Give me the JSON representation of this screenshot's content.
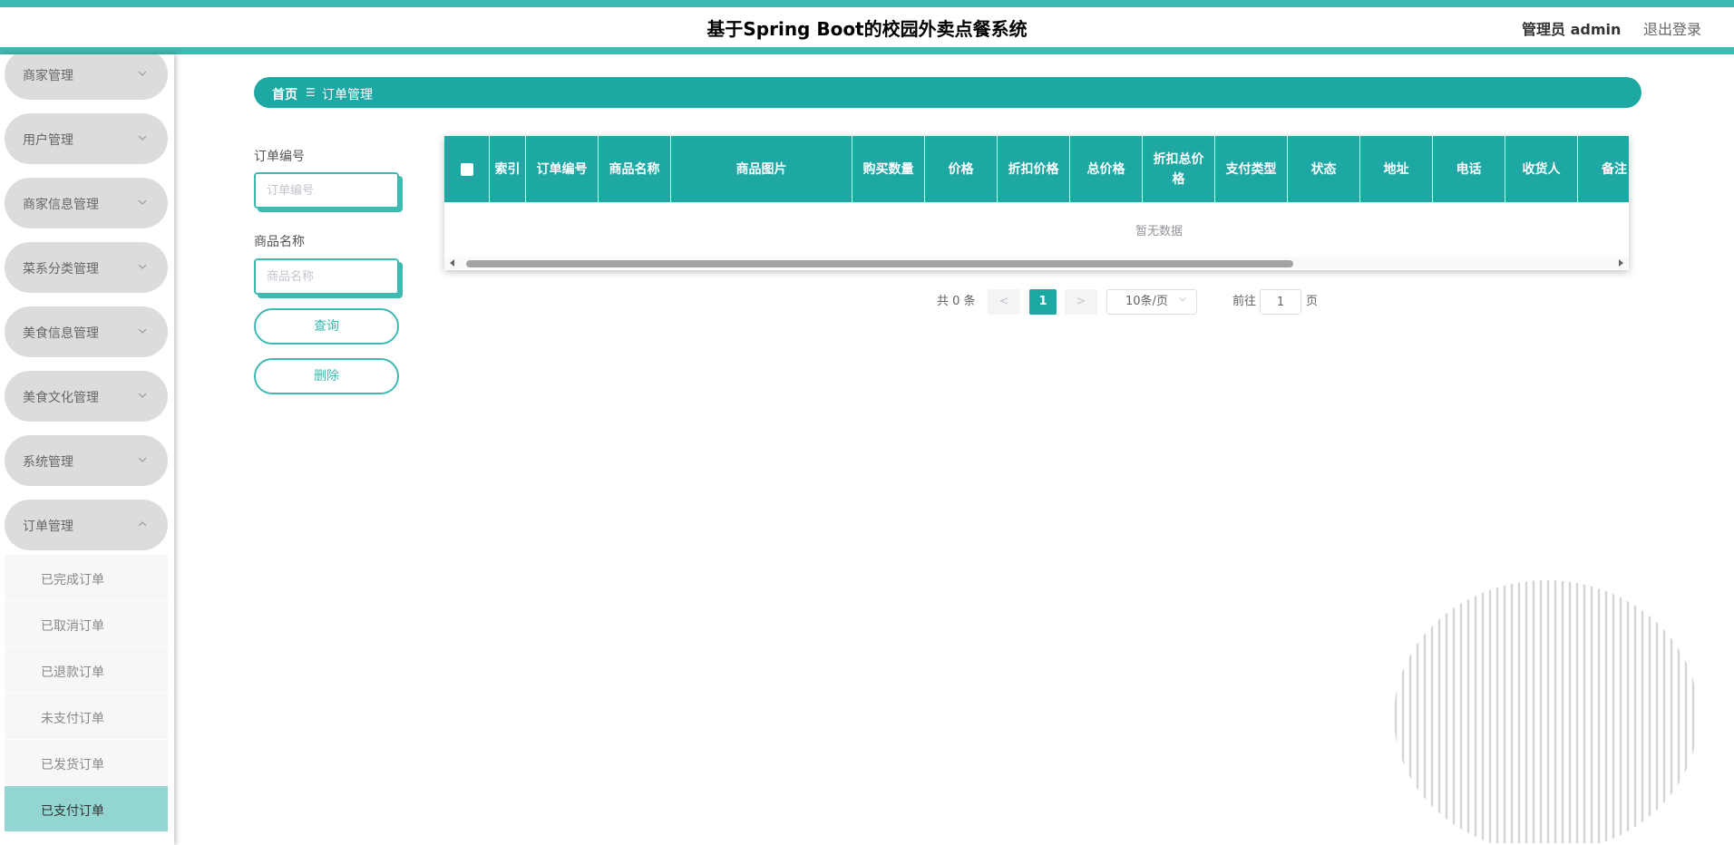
{
  "header": {
    "title": "基于Spring Boot的校园外卖点餐系统",
    "user": "管理员 admin",
    "logout": "退出登录",
    "accent_color": "#3dbab1"
  },
  "sidebar": {
    "menus": [
      {
        "label": "商家管理",
        "expanded": false
      },
      {
        "label": "用户管理",
        "expanded": false
      },
      {
        "label": "商家信息管理",
        "expanded": false
      },
      {
        "label": "菜系分类管理",
        "expanded": false
      },
      {
        "label": "美食信息管理",
        "expanded": false
      },
      {
        "label": "美食文化管理",
        "expanded": false
      },
      {
        "label": "系统管理",
        "expanded": false
      },
      {
        "label": "订单管理",
        "expanded": true
      }
    ],
    "submenu": [
      {
        "label": "已完成订单",
        "active": false
      },
      {
        "label": "已取消订单",
        "active": false
      },
      {
        "label": "已退款订单",
        "active": false
      },
      {
        "label": "未支付订单",
        "active": false
      },
      {
        "label": "已发货订单",
        "active": false
      },
      {
        "label": "已支付订单",
        "active": true
      }
    ]
  },
  "breadcrumb": {
    "home": "首页",
    "separator": "☰",
    "current": "订单管理"
  },
  "search": {
    "order_no_label": "订单编号",
    "order_no_placeholder": "订单编号",
    "order_no_value": "",
    "product_name_label": "商品名称",
    "product_name_placeholder": "商品名称",
    "product_name_value": "",
    "query_button": "查询",
    "delete_button": "删除"
  },
  "table": {
    "columns": [
      "索引",
      "订单编号",
      "商品名称",
      "商品图片",
      "购买数量",
      "价格",
      "折扣价格",
      "总价格",
      "折扣总价格",
      "支付类型",
      "状态",
      "地址",
      "电话",
      "收货人",
      "备注"
    ],
    "rows": [],
    "empty_text": "暂无数据"
  },
  "pagination": {
    "total_text": "共 0 条",
    "prev": "<",
    "current_page": "1",
    "next": ">",
    "page_size": "10条/页",
    "goto_label": "前往",
    "goto_value": "1",
    "goto_unit": "页"
  }
}
